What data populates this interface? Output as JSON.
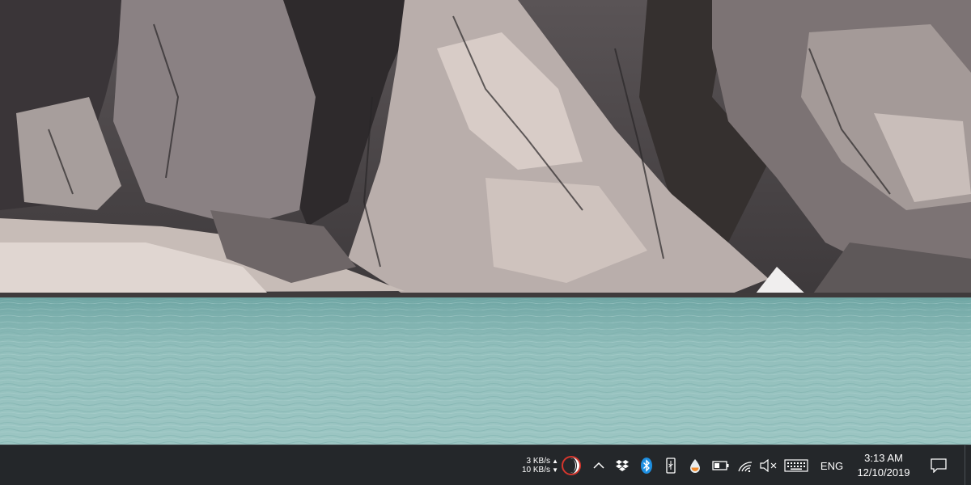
{
  "wallpaper": {
    "description_icon": "landscape-photo",
    "colors": {
      "rock": "#6a6264",
      "rock_light": "#d9cfca",
      "water": "#8fb9b6",
      "water_dark": "#5f9d9b"
    }
  },
  "taskbar": {
    "netspeed": {
      "upload": "3 KB/s",
      "download": "10 KB/s",
      "up_arrow": "▲",
      "down_arrow": "▼"
    },
    "icons": {
      "moon": "moon-icon",
      "chevron": "chevron-up-icon",
      "dropbox": "dropbox-icon",
      "bluetooth": "bluetooth-icon",
      "usb": "usb-icon",
      "drop": "water-drop-icon",
      "battery": "battery-icon",
      "wifi": "wifi-icon",
      "volume": "volume-muted-icon",
      "keyboard": "touch-keyboard-icon",
      "notifications": "action-center-icon"
    },
    "language": "ENG",
    "time": "3:13 AM",
    "date": "12/10/2019",
    "accent": "#1e8fe1"
  }
}
